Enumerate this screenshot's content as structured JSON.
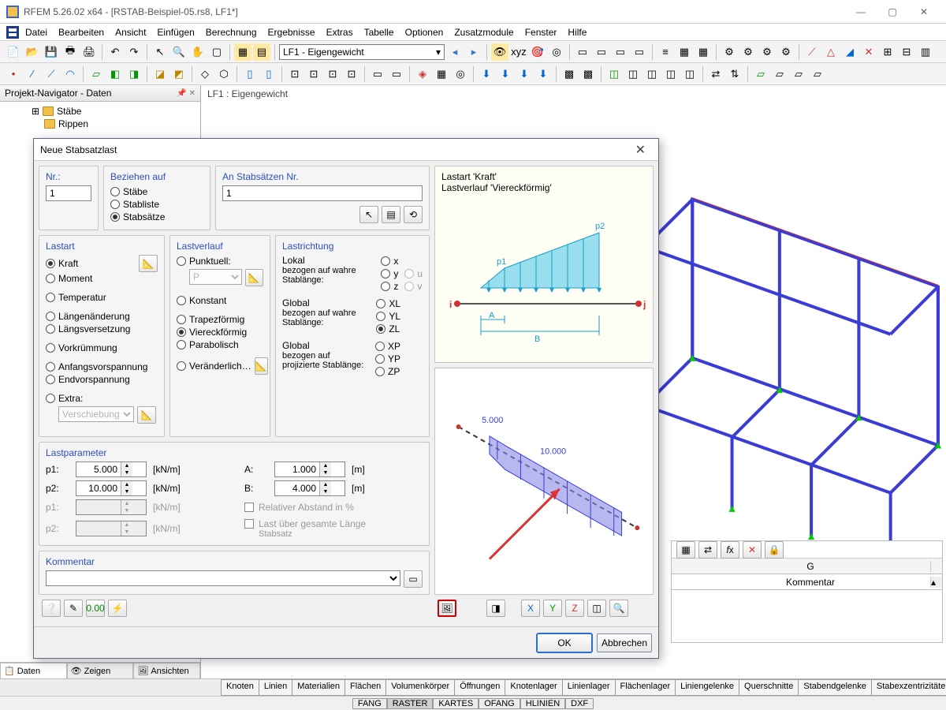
{
  "app": {
    "title": "RFEM 5.26.02 x64 - [RSTAB-Beispiel-05.rs8, LF1*]"
  },
  "menu": [
    "Datei",
    "Bearbeiten",
    "Ansicht",
    "Einfügen",
    "Berechnung",
    "Ergebnisse",
    "Extras",
    "Tabelle",
    "Optionen",
    "Zusatzmodule",
    "Fenster",
    "Hilfe"
  ],
  "lf_combo": "LF1 - Eigengewicht",
  "navigator": {
    "title": "Projekt-Navigator - Daten",
    "items": [
      "Stäbe",
      "Rippen"
    ],
    "tabs": [
      "Daten",
      "Zeigen",
      "Ansichten"
    ]
  },
  "canvas_label": "LF1 : Eigengewicht",
  "bottom_tabs": [
    "Knoten",
    "Linien",
    "Materialien",
    "Flächen",
    "Volumenkörper",
    "Öffnungen",
    "Knotenlager",
    "Linienlager",
    "Flächenlager",
    "Liniengelenke",
    "Querschnitte",
    "Stabendgelenke",
    "Stabexzentrizitäten"
  ],
  "status": [
    "FANG",
    "RASTER",
    "KARTES",
    "OFANG",
    "HLINIEN",
    "DXF"
  ],
  "dialog": {
    "title": "Neue Stabsatzlast",
    "nr": {
      "label": "Nr.:",
      "value": "1"
    },
    "beziehen": {
      "label": "Beziehen auf",
      "options": [
        "Stäbe",
        "Stabliste",
        "Stabsätze"
      ],
      "selected": "Stabsätze"
    },
    "anStab": {
      "label": "An Stabsätzen Nr.",
      "value": "1"
    },
    "lastart": {
      "label": "Lastart",
      "options": [
        "Kraft",
        "Moment",
        "Temperatur",
        "Längenänderung",
        "Längsversetzung",
        "Vorkrümmung",
        "Anfangsvorspannung",
        "Endvorspannung",
        "Extra:"
      ],
      "selected": "Kraft",
      "extra_combo": "Verschiebung"
    },
    "lastverlauf": {
      "label": "Lastverlauf",
      "options": [
        "Punktuell:",
        "Konstant",
        "Trapezförmig",
        "Viereckförmig",
        "Parabolisch",
        "Veränderlich…"
      ],
      "selected": "Viereckförmig",
      "punkt_combo": "P"
    },
    "lastrichtung": {
      "label": "Lastrichtung",
      "lokal": {
        "label": "Lokal",
        "sub": "bezogen auf wahre Stablänge:",
        "opts": [
          "x",
          "y",
          "z"
        ],
        "altopts": [
          "u",
          "v"
        ]
      },
      "global1": {
        "label": "Global",
        "sub": "bezogen auf wahre Stablänge:",
        "opts": [
          "XL",
          "YL",
          "ZL"
        ],
        "selected": "ZL"
      },
      "global2": {
        "label": "Global",
        "sub": "bezogen auf projizierte Stablänge:",
        "opts": [
          "XP",
          "YP",
          "ZP"
        ]
      }
    },
    "lastparameter": {
      "label": "Lastparameter",
      "p1": {
        "label": "p1:",
        "value": "5.000",
        "unit": "[kN/m]"
      },
      "p2": {
        "label": "p2:",
        "value": "10.000",
        "unit": "[kN/m]"
      },
      "p1b": {
        "label": "p1:",
        "value": "",
        "unit": "[kN/m]"
      },
      "p2b": {
        "label": "p2:",
        "value": "",
        "unit": "[kN/m]"
      },
      "A": {
        "label": "A:",
        "value": "1.000",
        "unit": "[m]"
      },
      "B": {
        "label": "B:",
        "value": "4.000",
        "unit": "[m]"
      },
      "relativ": "Relativer Abstand in %",
      "gesamt": "Last über gesamte Länge",
      "gesamt_sub": "Stabsatz"
    },
    "kommentar": {
      "label": "Kommentar",
      "value": ""
    },
    "preview": {
      "line1": "Lastart 'Kraft'",
      "line2": "Lastverlauf 'Viereckförmig'",
      "p1": "p1",
      "p2": "p2",
      "A": "A",
      "B": "B",
      "i": "i",
      "j": "j"
    },
    "preview2": {
      "v1": "5.000",
      "v2": "10.000"
    },
    "ok": "OK",
    "cancel": "Abbrechen"
  },
  "grid": {
    "col": "G",
    "header": "Kommentar"
  }
}
